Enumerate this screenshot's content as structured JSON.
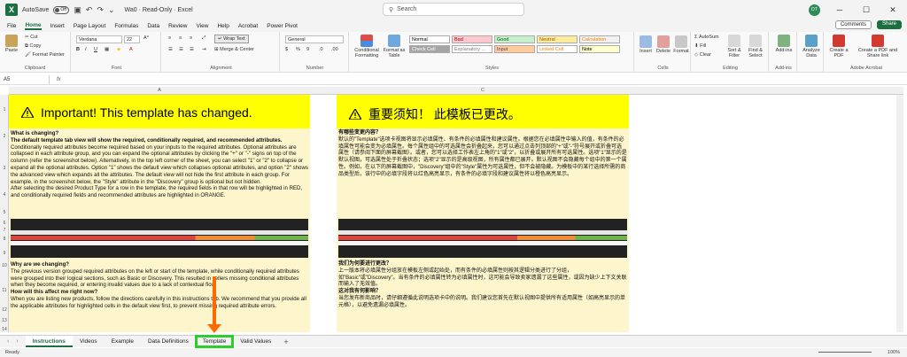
{
  "titlebar": {
    "autosave_label": "AutoSave",
    "toggle_state": "Off",
    "doc_title": "Wa0 · Read-Only · Excel",
    "search_placeholder": "Search",
    "avatar_initials": "DT"
  },
  "menu": {
    "tabs": [
      "File",
      "Home",
      "Insert",
      "Page Layout",
      "Formulas",
      "Data",
      "Review",
      "View",
      "Help",
      "Acrobat",
      "Power Pivot"
    ],
    "active_tab": "Home",
    "comments_label": "Comments",
    "share_label": "Share"
  },
  "ribbon": {
    "clipboard": {
      "paste": "Paste",
      "cut": "Cut",
      "copy": "Copy",
      "format_painter": "Format Painter",
      "label": "Clipboard"
    },
    "font": {
      "font_name": "Verdana",
      "font_size": "22",
      "label": "Font"
    },
    "alignment": {
      "wrap_text": "Wrap Text",
      "merge_center": "Merge & Center",
      "label": "Alignment"
    },
    "number": {
      "format": "General",
      "label": "Number"
    },
    "styles": {
      "conditional": "Conditional Formatting",
      "format_table": "Format as Table",
      "items": [
        {
          "label": "Normal",
          "bg": "#ffffff",
          "fg": "#000000"
        },
        {
          "label": "Bad",
          "bg": "#ffc7ce",
          "fg": "#9c0006"
        },
        {
          "label": "Good",
          "bg": "#c6efce",
          "fg": "#006100"
        },
        {
          "label": "Neutral",
          "bg": "#ffeb9c",
          "fg": "#9c5700"
        },
        {
          "label": "Calculation",
          "bg": "#f2f2f2",
          "fg": "#fa7d00"
        },
        {
          "label": "Check Cell",
          "bg": "#a5a5a5",
          "fg": "#ffffff"
        },
        {
          "label": "Explanatory ...",
          "bg": "#ffffff",
          "fg": "#7f7f7f"
        },
        {
          "label": "Input",
          "bg": "#ffcc99",
          "fg": "#3f3f76"
        },
        {
          "label": "Linked Cell",
          "bg": "#ffffff",
          "fg": "#fa7d00"
        },
        {
          "label": "Note",
          "bg": "#ffffcc",
          "fg": "#000000"
        }
      ],
      "label": "Styles"
    },
    "cells": {
      "insert": "Insert",
      "delete": "Delete",
      "format": "Format",
      "label": "Cells"
    },
    "editing": {
      "autosum": "AutoSum",
      "fill": "Fill",
      "clear": "Clear",
      "sort": "Sort & Filter",
      "find": "Find & Select",
      "label": "Editing"
    },
    "addins": {
      "addins": "Add-ins",
      "label": "Add-ins"
    },
    "analyze": {
      "analyze": "Analyze Data"
    },
    "acrobat": {
      "create_pdf": "Create a PDF",
      "create_share": "Create a PDF and Share link",
      "label": "Adobe Acrobat"
    }
  },
  "formula_bar": {
    "name_box": "A5",
    "fx": "fx"
  },
  "columns": {
    "a": "A",
    "c": "C"
  },
  "rows": [
    "1",
    "2",
    "3",
    "4",
    "5",
    "6",
    "7",
    "8",
    "9",
    "10",
    "11",
    "12",
    "13",
    "14"
  ],
  "content": {
    "banner_en": "Important! This template has changed.",
    "banner_zh": "重要须知！ 此模板已更改。",
    "en": {
      "h1": "What is changing?",
      "p1b": "The default template tab view will show the required, conditionally required, and recommended attributes.",
      "p1": "Conditionally required attributes become required based on your inputs to the required attributes. Optional attributes are collapsed in each attribute group, and you can expand the optional attributes by clicking the \"+\" or \"-\" signs on top of the column (refer the screenshot below). Alternatively, in the top left corner of the sheet, you can select \"1\" or \"2\" to collapse or expand all the optional attributes. Option \"1\" shows the default view which collapses optional attributes, and option \"2\" shows the advanced view which expands all the attributes. The default view will not hide the first attribute in each group. For example, in the screenshot below, the \"Style\" attribute in the \"Discovery\" group is optional but not hidden.",
      "p2": "After selecting the desired Product Type for a row in the template, the required fields in that row will be highlighted in RED, and conditionally required fields and recommended attributes are highlighted in ORANGE.",
      "h2": "Why are we changing?",
      "p3": "The previous version grouped required attributes on the left or start of the template, while conditionally required attributes were grouped into their logical sections, such as Basic or Discovery. This resulted in sellers missing conditional attributes when they become required, or entering invalid values due to a lack of contextual flow.",
      "h3": "How will this affect me right now?",
      "p4": "When you are listing new products, follow the directions carefully in this instructions tab. We recommend that you provide all the applicable attributes for highlighted cells in the default view first, to prevent missing required attribute errors."
    },
    "zh": {
      "h1": "有哪些变更内容？",
      "p1": "默认的\"Template\"选项卡视图将显示必填属性、有条件的必填属性和建议属性。根据您在必填属性中输入的值，有条件的必填属性可能会变为必填属性。每个属性组中的可选属性会折叠起来，您可以通过点击列顶部的\"+\"或\"-\"符号展开或折叠可选属性（请参阅下面的屏幕截图）。或者，您可以选择工作表左上角的\"1\"或\"2\"，以折叠或展开所有可选属性。选项\"1\"显示的是默认视图，可选属性处于折叠状态；选项\"2\"显示的是高级视图，所有属性都已展开。默认视图不会隐藏每个组中的第一个属性。例如，在以下的屏幕截图中，\"Discovery\"组中的\"Style\"属性为可选属性，但不会被隐藏。为模板中的某行选择所需的商品类型后，该行中的必填字段将以红色高亮显示，有条件的必填字段和建议属性将以橙色高亮显示。",
      "h2": "我们为何要进行更改？",
      "p2": "上一版本将必填属性分组放在模板左侧或起始处，而有条件的必填属性则按其逻辑分类进行了分组，如\"Basic\"或\"Discovery\"。当有条件的必填属性转为必填属性时，这可能会导致卖家遗漏了这些属性，或因为缺少上下文关联而输入了无效值。",
      "h3": "这对我有何影响？",
      "p3": "当您发布新商品时，请仔细遵循此说明选项卡中的说明。我们建议您首先在默认视图中提供所有适用属性（如高亮显示的单元格），以避免遗漏必填属性。"
    }
  },
  "sheet_tabs": [
    "Instructions",
    "Videos",
    "Example",
    "Data Definitions",
    "Template",
    "Valid Values"
  ],
  "active_sheet": "Instructions",
  "highlighted_sheet": "Template",
  "status": {
    "ready": "Ready",
    "zoom": "100%"
  },
  "colors": {
    "accent": "#1d6f42",
    "highlight_green": "#2ecc2e",
    "arrow_orange": "#ff6a00",
    "banner_yellow": "#ffff00"
  }
}
